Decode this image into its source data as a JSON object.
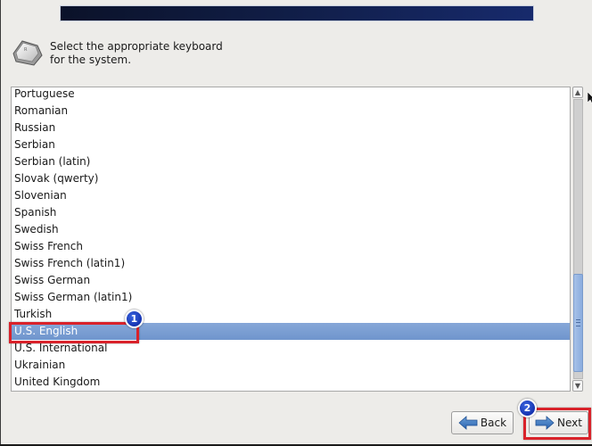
{
  "header": {
    "icon": "keyboard-key-icon",
    "instruction": "Select the appropriate keyboard for the system."
  },
  "keyboard_list": {
    "items": [
      "Portuguese",
      "Romanian",
      "Russian",
      "Serbian",
      "Serbian (latin)",
      "Slovak (qwerty)",
      "Slovenian",
      "Spanish",
      "Swedish",
      "Swiss French",
      "Swiss French (latin1)",
      "Swiss German",
      "Swiss German (latin1)",
      "Turkish",
      "U.S. English",
      "U.S. International",
      "Ukrainian",
      "United Kingdom"
    ],
    "selected": "U.S. English",
    "scroll_position": 0.96,
    "visible_fraction": 0.35
  },
  "scrollbar": {
    "up_icon": "chevron-up-icon",
    "down_icon": "chevron-down-icon"
  },
  "buttons": {
    "back_label": "Back",
    "next_label": "Next"
  },
  "annotations": [
    {
      "number": "1",
      "target": "U.S. English"
    },
    {
      "number": "2",
      "target": "Next"
    }
  ],
  "colors": {
    "selection": "#7196cf",
    "annotation_box": "#d9222a",
    "badge": "#1a3bc4",
    "banner": "#101d45"
  }
}
